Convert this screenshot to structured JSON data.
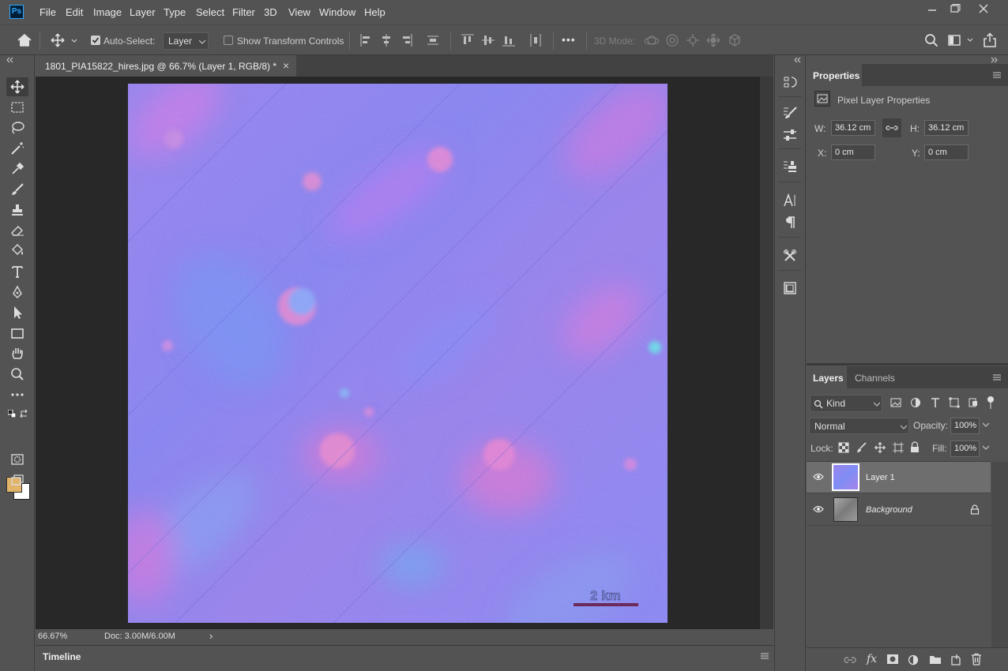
{
  "app": {
    "logo": "Ps"
  },
  "menu": [
    "File",
    "Edit",
    "Image",
    "Layer",
    "Type",
    "Select",
    "Filter",
    "3D",
    "View",
    "Window",
    "Help"
  ],
  "options": {
    "auto_select_label": "Auto-Select:",
    "auto_select_checked": true,
    "auto_select_target": "Layer",
    "show_transform_label": "Show Transform Controls",
    "show_transform_checked": false,
    "mode_3d_label": "3D Mode:",
    "more": "•••"
  },
  "document": {
    "tab_title": "1801_PIA15822_hires.jpg @ 66.7% (Layer 1, RGB/8) *",
    "close": "×",
    "scale_label": "2 km",
    "zoom": "66.67%",
    "doc_size": "Doc: 3.00M/6.00M",
    "status_arrow": "›"
  },
  "timeline": {
    "label": "Timeline"
  },
  "colors": {
    "foreground": "#e2b46a",
    "background": "#ffffff",
    "accent": "#31a8ff"
  },
  "properties": {
    "tab": "Properties",
    "kind": "Pixel Layer Properties",
    "w_label": "W:",
    "w_value": "36.12 cm",
    "h_label": "H:",
    "h_value": "36.12 cm",
    "x_label": "X:",
    "x_value": "0 cm",
    "y_label": "Y:",
    "y_value": "0 cm"
  },
  "layers_panel": {
    "tabs": [
      "Layers",
      "Channels"
    ],
    "filter_kind": "Kind",
    "blend_mode": "Normal",
    "opacity_label": "Opacity:",
    "opacity_value": "100%",
    "lock_label": "Lock:",
    "fill_label": "Fill:",
    "fill_value": "100%",
    "layers": [
      {
        "name": "Layer 1",
        "visible": true,
        "selected": true,
        "locked": false
      },
      {
        "name": "Background",
        "visible": true,
        "selected": false,
        "locked": true
      }
    ]
  }
}
